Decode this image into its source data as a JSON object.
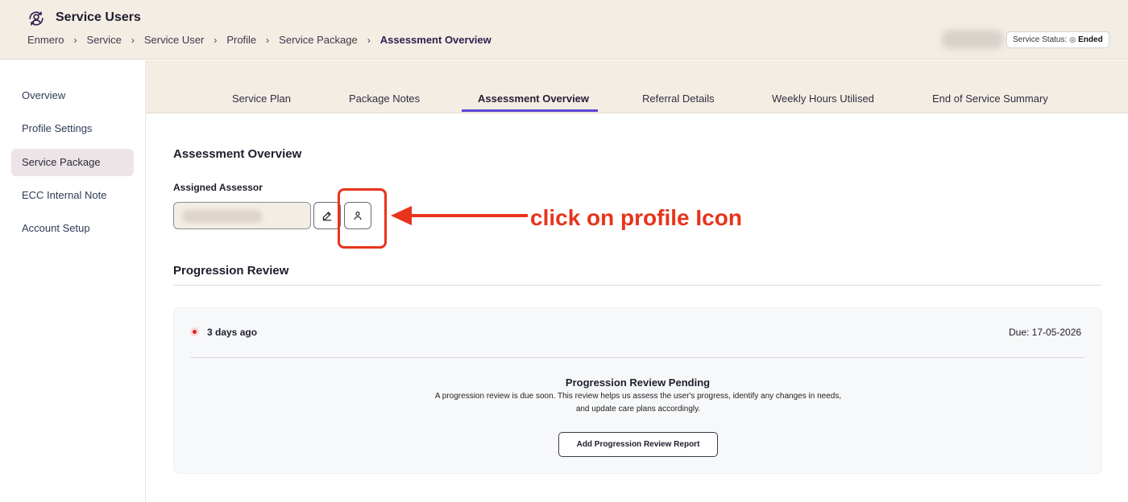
{
  "header": {
    "app_icon": "users-sync-icon",
    "title": "Service Users",
    "breadcrumb": [
      "Enmero",
      "Service",
      "Service User",
      "Profile",
      "Service Package",
      "Assessment Overview"
    ],
    "status_label": "Service Status:",
    "status_icon": "circle-dot-icon",
    "status_value": "Ended"
  },
  "sidebar": {
    "items": [
      {
        "label": "Overview",
        "active": false
      },
      {
        "label": "Profile Settings",
        "active": false
      },
      {
        "label": "Service Package",
        "active": true
      },
      {
        "label": "ECC Internal Note",
        "active": false
      },
      {
        "label": "Account Setup",
        "active": false
      }
    ]
  },
  "tabs": [
    {
      "label": "Service Plan",
      "active": false
    },
    {
      "label": "Package Notes",
      "active": false
    },
    {
      "label": "Assessment Overview",
      "active": true
    },
    {
      "label": "Referral Details",
      "active": false
    },
    {
      "label": "Weekly Hours Utilised",
      "active": false
    },
    {
      "label": "End of Service Summary",
      "active": false
    }
  ],
  "main": {
    "title": "Assessment Overview",
    "assessor": {
      "label": "Assigned Assessor",
      "edit_icon": "pencil-icon",
      "profile_icon": "user-icon"
    },
    "annotation": {
      "text": "click on profile Icon",
      "color": "#e8341c"
    },
    "progression": {
      "title": "Progression Review",
      "time_ago": "3 days ago",
      "due": "Due: 17-05-2026",
      "pending_title": "Progression Review Pending",
      "pending_text": "A progression review is due soon. This review helps us assess the user's progress, identify any changes in needs, and update care plans accordingly.",
      "button_label": "Add Progression Review Report"
    }
  },
  "colors": {
    "header_bg": "#f4ede4",
    "accent": "#5b45d6",
    "annotation": "#e8341c",
    "status_dot": "#e0242a"
  }
}
